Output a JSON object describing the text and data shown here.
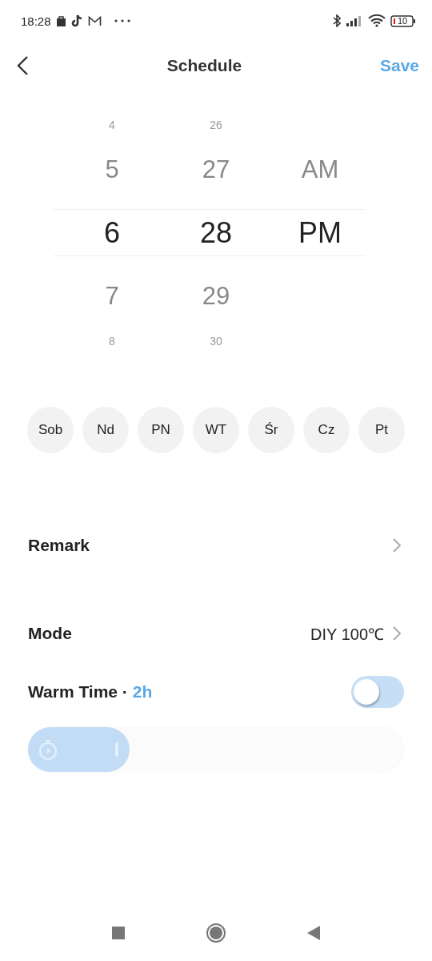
{
  "status_bar": {
    "time": "18:28",
    "battery": "10"
  },
  "header": {
    "title": "Schedule",
    "action": "Save"
  },
  "picker": {
    "columns": [
      {
        "items": [
          {
            "label": "4",
            "selected": false
          },
          {
            "label": "5",
            "selected": false
          },
          {
            "label": "6",
            "selected": true
          },
          {
            "label": "7",
            "selected": false
          },
          {
            "label": "8",
            "selected": false
          }
        ]
      },
      {
        "items": [
          {
            "label": "26",
            "selected": false
          },
          {
            "label": "27",
            "selected": false
          },
          {
            "label": "28",
            "selected": true
          },
          {
            "label": "29",
            "selected": false
          },
          {
            "label": "30",
            "selected": false
          }
        ]
      },
      {
        "items": [
          {
            "label": "AM",
            "selected": false
          },
          {
            "label": "PM",
            "selected": true
          }
        ]
      }
    ]
  },
  "days": [
    {
      "label": "Sob",
      "selected": false
    },
    {
      "label": "Nd",
      "selected": false
    },
    {
      "label": "PN",
      "selected": false
    },
    {
      "label": "WT",
      "selected": false
    },
    {
      "label": "Śr",
      "selected": false
    },
    {
      "label": "Cz",
      "selected": false
    },
    {
      "label": "Pt",
      "selected": false
    }
  ],
  "settings": [
    {
      "label": "Remark"
    },
    {
      "label": "Mode",
      "value": "DIY 100℃"
    }
  ],
  "warm_time": {
    "label": "Warm Time · ",
    "value": "2h",
    "on": false,
    "level": 0.27
  }
}
